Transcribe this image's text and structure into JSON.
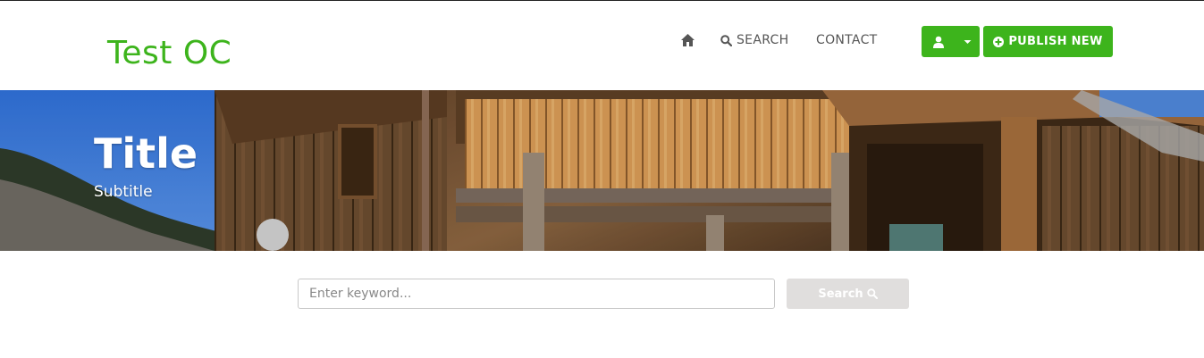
{
  "header": {
    "brand": "Test OC",
    "nav": {
      "home_icon": "home-icon",
      "search_label": "SEARCH",
      "contact_label": "CONTACT"
    },
    "user_button": {
      "icon": "user-icon",
      "caret_icon": "caret-down-icon"
    },
    "publish_label": "PUBLISH NEW",
    "publish_icon": "plus-circle-icon"
  },
  "hero": {
    "title": "Title",
    "subtitle": "Subtitle"
  },
  "search": {
    "placeholder": "Enter keyword...",
    "button_label": "Search",
    "button_icon": "search-icon"
  },
  "colors": {
    "brand": "#3db41c",
    "search_button": "#e0dedd"
  }
}
